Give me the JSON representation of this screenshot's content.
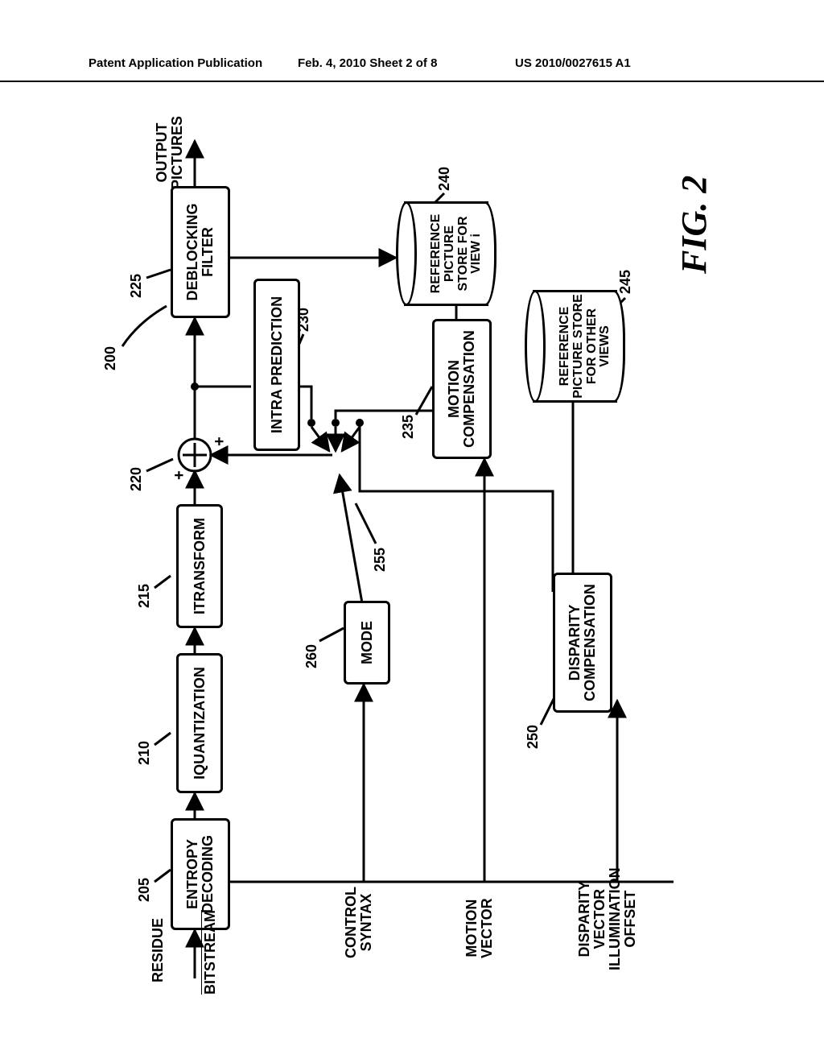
{
  "header": {
    "left": "Patent Application Publication",
    "center": "Feb. 4, 2010   Sheet 2 of 8",
    "right": "US 2010/0027615 A1"
  },
  "labels": {
    "figure": "FIG. 2",
    "residue": "RESIDUE",
    "bitstream": "BITSTREAM",
    "output": "OUTPUT\nPICTURES",
    "control_syntax": "CONTROL\nSYNTAX",
    "motion_vector": "MOTION\nVECTOR",
    "dvio": "DISPARITY\nVECTOR\nILLUMINATION\nOFFSET"
  },
  "blocks": {
    "entropy": "ENTROPY\nDECODING",
    "iquant": "IQUANTIZATION",
    "itransform": "ITRANSFORM",
    "deblocking": "DEBLOCKING\nFILTER",
    "intra": "INTRA PREDICTION",
    "motion_comp": "MOTION\nCOMPENSATION",
    "disparity": "DISPARITY\nCOMPENSATION",
    "mode": "MODE",
    "ref_i": "REFERENCE\nPICTURE\nSTORE FOR\nVIEW i",
    "ref_other": "REFERENCE\nPICTURE\nSTORE FOR\nOTHER VIEWS"
  },
  "refs": {
    "r200": "200",
    "r205": "205",
    "r210": "210",
    "r215": "215",
    "r220": "220",
    "r225": "225",
    "r230": "230",
    "r235": "235",
    "r240": "240",
    "r245": "245",
    "r250": "250",
    "r255": "255",
    "r260": "260"
  }
}
